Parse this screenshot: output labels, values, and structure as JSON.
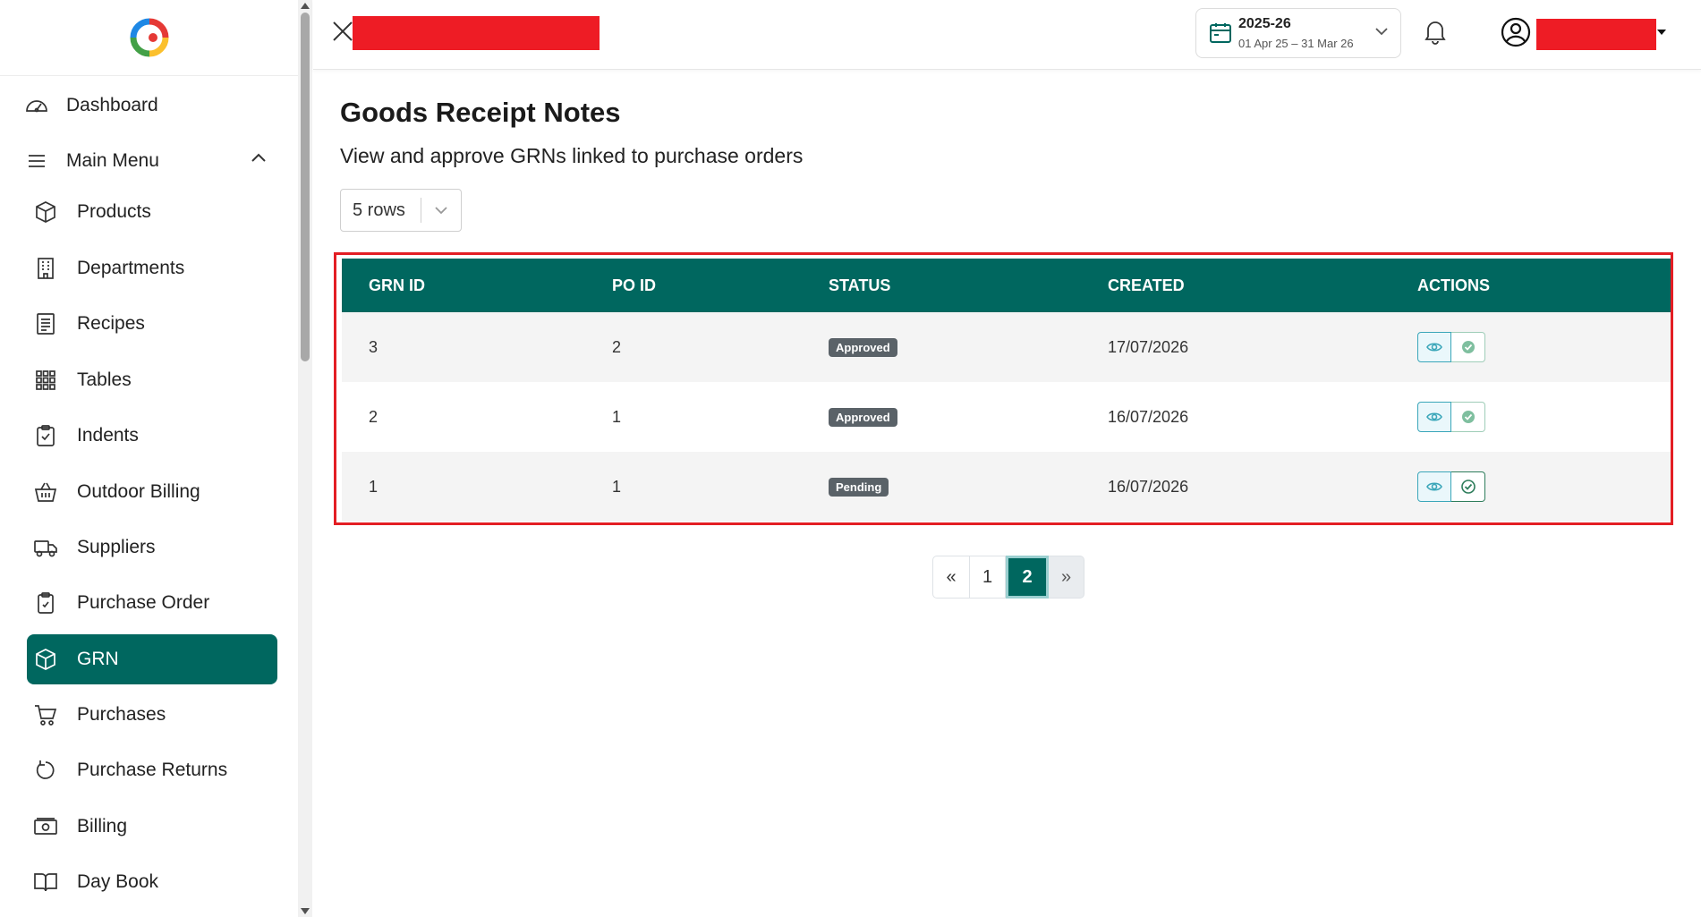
{
  "sidebar": {
    "items": [
      {
        "label": "Dashboard",
        "icon": "speedometer-icon"
      },
      {
        "label": "Main Menu",
        "icon": "menu-icon"
      },
      {
        "label": "Products",
        "icon": "box-icon"
      },
      {
        "label": "Departments",
        "icon": "building-icon"
      },
      {
        "label": "Recipes",
        "icon": "list-document-icon"
      },
      {
        "label": "Tables",
        "icon": "grid-icon"
      },
      {
        "label": "Indents",
        "icon": "clipboard-icon"
      },
      {
        "label": "Outdoor Billing",
        "icon": "basket-icon"
      },
      {
        "label": "Suppliers",
        "icon": "truck-icon"
      },
      {
        "label": "Purchase Order",
        "icon": "clipboard-check-icon"
      },
      {
        "label": "GRN",
        "icon": "box-icon"
      },
      {
        "label": "Purchases",
        "icon": "cart-icon"
      },
      {
        "label": "Purchase Returns",
        "icon": "refresh-icon"
      },
      {
        "label": "Billing",
        "icon": "cash-icon"
      },
      {
        "label": "Day Book",
        "icon": "book-icon"
      }
    ],
    "active": "GRN"
  },
  "header": {
    "fiscal_year": "2025-26",
    "fiscal_range": "01 Apr 25 – 31 Mar 26"
  },
  "main": {
    "title": "Goods Receipt Notes",
    "subtitle": "View and approve GRNs linked to purchase orders",
    "rows_select": "5 rows",
    "table": {
      "columns": [
        "GRN ID",
        "PO ID",
        "STATUS",
        "CREATED",
        "ACTIONS"
      ],
      "rows": [
        {
          "grn_id": "3",
          "po_id": "2",
          "status": "Approved",
          "created": "17/07/2026"
        },
        {
          "grn_id": "2",
          "po_id": "1",
          "status": "Approved",
          "created": "16/07/2026"
        },
        {
          "grn_id": "1",
          "po_id": "1",
          "status": "Pending",
          "created": "16/07/2026"
        }
      ]
    },
    "pagination": {
      "prev": "«",
      "pages": [
        "1",
        "2"
      ],
      "current": "2",
      "next": "»"
    }
  },
  "colors": {
    "brand": "#00675f",
    "highlight": "#e31e24",
    "redaction": "#ee1c25"
  }
}
